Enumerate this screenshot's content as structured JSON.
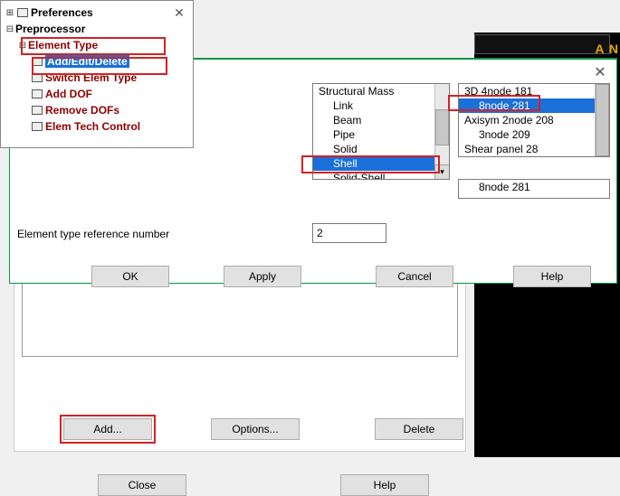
{
  "tree": {
    "preferences": "Preferences",
    "preprocessor": "Preprocessor",
    "elementType": "Element Type",
    "items": {
      "addEditDelete": "Add/Edit/Delete",
      "switchElemType": "Switch Elem Type",
      "addDOF": "Add DOF",
      "removeDOFs": "Remove DOFs",
      "elemTechControl": "Elem Tech Control"
    }
  },
  "typesPanel": {
    "add": "Add...",
    "options": "Options...",
    "delete": "Delete",
    "close": "Close",
    "help": "Help"
  },
  "libDialog": {
    "categories": {
      "a": "Structural Mass",
      "b": "Link",
      "c": "Beam",
      "d": "Pipe",
      "e": "Solid",
      "f": "Shell",
      "g": "Solid-Shell"
    },
    "subtypes": {
      "a": "3D    4node 181",
      "b": "8node 281",
      "c": "Axisym 2node 208",
      "d": "3node 209",
      "e": "Shear panel   28"
    },
    "selectedOut": "8node 281",
    "refLabel": "Element type reference number",
    "refValue": "2",
    "ok": "OK",
    "apply": "Apply",
    "cancel": "Cancel",
    "help": "Help"
  },
  "bg": {
    "an": "A N"
  }
}
